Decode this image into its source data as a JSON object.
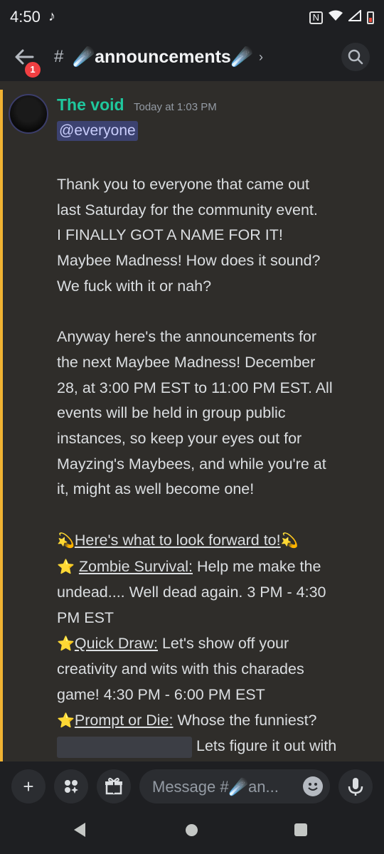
{
  "status_bar": {
    "time": "4:50",
    "tiktok_icon": "tiktok-icon"
  },
  "header": {
    "badge_count": "1",
    "hash": "#",
    "channel_name": "☄️announcements☄️",
    "chevron": "›"
  },
  "message": {
    "author": "The void",
    "author_color": "#1fc79d",
    "timestamp": "Today at 1:03 PM",
    "mention": "@everyone",
    "paragraph1": [
      "Thank you to everyone that came out",
      "last Saturday for the community event.",
      "I FINALLY GOT A NAME FOR IT!",
      "Maybee Madness! How does it sound?",
      "We fuck with it or nah?"
    ],
    "paragraph2": [
      "Anyway here's the announcements for",
      "the next Maybee Madness! December",
      "28, at 3:00 PM EST to 11:00 PM EST. All",
      "events will be held in group public",
      "instances, so keep your eyes out for",
      "Mayzing's Maybees, and while you're at",
      "it, might as well become one!"
    ],
    "heading_emoji": "💫",
    "heading_text": "Here's what to look forward to!",
    "star_emoji": "⭐",
    "events": [
      {
        "title": "Zombie Survival:",
        "line1": " Help me make the",
        "line2": "undead.... Well dead again. 3 PM - 4:30",
        "line3": "PM EST"
      },
      {
        "title": "Quick Draw:",
        "line1": " Let's show off your",
        "line2": "creativity and wits with this charades",
        "line3": "game! 4:30 PM - 6:00 PM EST"
      },
      {
        "title": "Prompt or Die:",
        "line1": " Whose the funniest?",
        "line2": "Lets figure it out with"
      }
    ]
  },
  "composer": {
    "placeholder": "Message #☄️an...",
    "add_icon": "+",
    "apps_icon": "apps-icon",
    "gift_icon": "gift-icon",
    "mic_icon": "mic-icon"
  },
  "colors": {
    "background": "#2f2d2a",
    "mention_bar": "#f0b232",
    "mention_bg": "#3c4270",
    "badge": "#f23f42"
  }
}
